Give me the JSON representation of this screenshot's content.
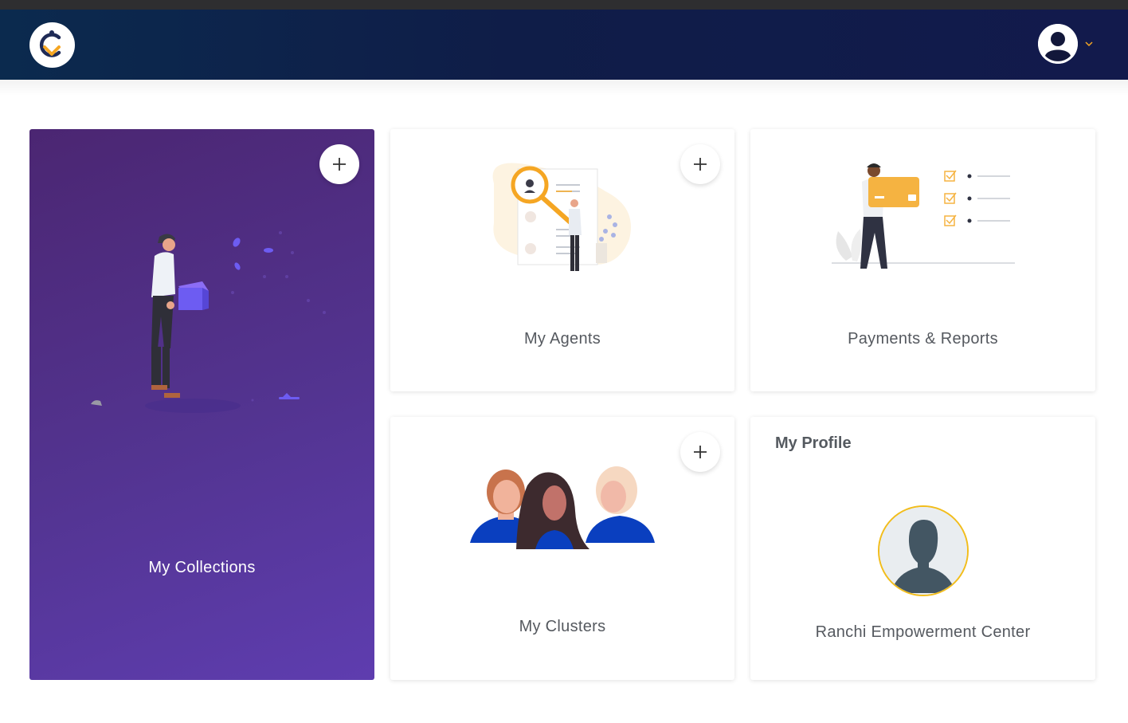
{
  "header": {
    "logo_icon": "app-logo-icon",
    "user_icon": "user-avatar-icon",
    "chevron_icon": "chevron-down-icon",
    "colors": {
      "header_start": "#0b2a4e",
      "header_end": "#121a4c",
      "accent": "#f5a623"
    }
  },
  "cards": {
    "collections": {
      "label": "My Collections",
      "add_icon": "plus-icon",
      "color": "#533491"
    },
    "agents": {
      "label": "My Agents",
      "add_icon": "plus-icon"
    },
    "payments": {
      "label": "Payments & Reports"
    },
    "clusters": {
      "label": "My Clusters",
      "add_icon": "plus-icon"
    },
    "profile": {
      "title": "My Profile",
      "name": "Ranchi Empowerment Center",
      "avatar_ring_color": "#f2bd1b"
    }
  }
}
